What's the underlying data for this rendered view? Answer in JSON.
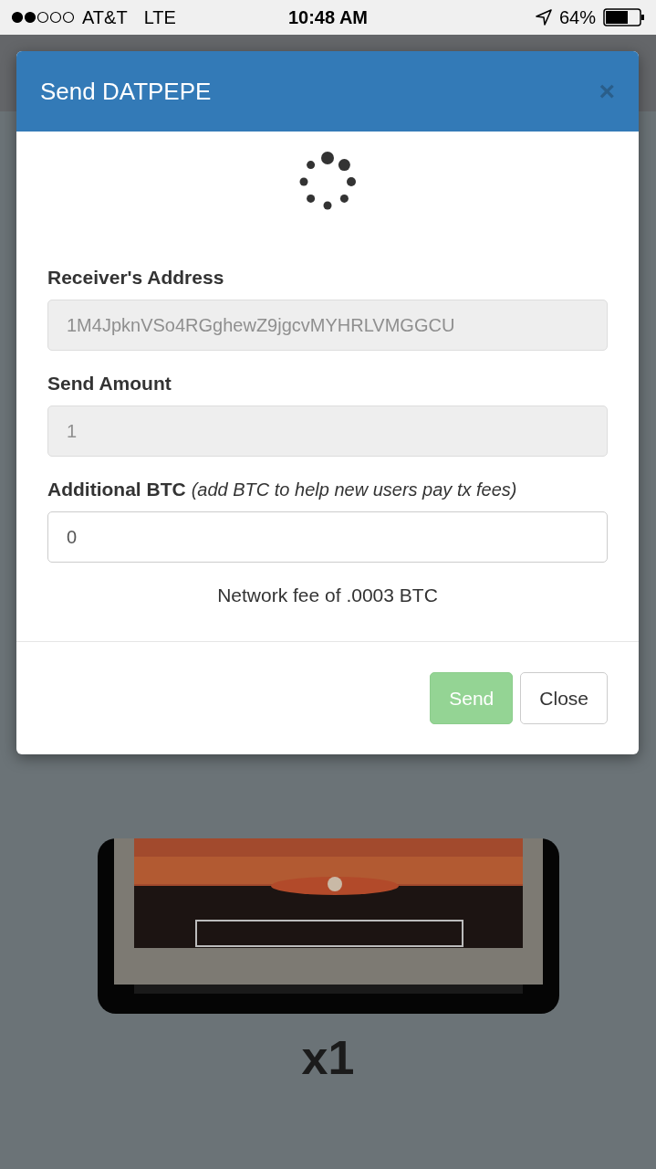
{
  "status_bar": {
    "carrier": "AT&T",
    "network": "LTE",
    "time": "10:48 AM",
    "battery": "64%"
  },
  "modal": {
    "title": "Send DATPEPE",
    "close": "×",
    "loading": true,
    "fields": [
      {
        "label": "Receiver's Address",
        "value": "1M4JpknVSo4RGghewZ9jgcvMYHRLVMGGCU",
        "disabled": true
      },
      {
        "label": "Send Amount",
        "value": "1",
        "disabled": true
      },
      {
        "label": "Additional BTC",
        "hint": "(add BTC to help new users pay tx fees)",
        "value": "0",
        "disabled": false
      }
    ],
    "fee_text": "Network fee of .0003 BTC",
    "buttons": [
      {
        "label": "Send",
        "kind": "primary",
        "disabled": true
      },
      {
        "label": "Close",
        "kind": "default",
        "disabled": false
      }
    ]
  },
  "card": {
    "kind": "picture",
    "count": "x1"
  }
}
